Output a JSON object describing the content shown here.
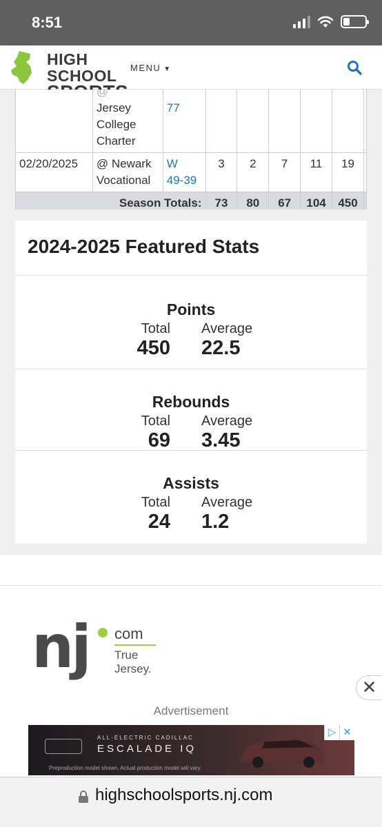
{
  "status_bar": {
    "time": "8:51"
  },
  "header": {
    "logo_line1": "HIGH SCHOOL",
    "logo_line2": "SPORTS",
    "menu_label": "MENU"
  },
  "game_log": {
    "partial_row": {
      "opponent": [
        "@ ",
        "Jersey",
        "College",
        "Charter"
      ],
      "result_tail": "77"
    },
    "row": {
      "date": "02/20/2025",
      "opponent_line1": "@ Newark",
      "opponent_line2": "Vocational",
      "result_line1": "W",
      "result_line2": "49-39",
      "stats": [
        "3",
        "2",
        "7",
        "11",
        "19"
      ]
    },
    "totals": {
      "label": "Season Totals:",
      "values": [
        "73",
        "80",
        "67",
        "104",
        "450"
      ]
    }
  },
  "featured": {
    "title": "2024-2025 Featured Stats",
    "total_label": "Total",
    "average_label": "Average",
    "stats": [
      {
        "name": "Points",
        "total": "450",
        "average": "22.5"
      },
      {
        "name": "Rebounds",
        "total": "69",
        "average": "3.45"
      },
      {
        "name": "Assists",
        "total": "24",
        "average": "1.2"
      }
    ]
  },
  "footer_logo": {
    "brand": "nj",
    "dot": "com",
    "tag1": "True",
    "tag2": "Jersey."
  },
  "ad": {
    "label": "Advertisement",
    "brand": "ALL-ELECTRIC CADILLAC",
    "model": "ESCALADE IQ",
    "fine_print": "Preproduction model shown. Actual production model will vary."
  },
  "url_bar": {
    "url": "highschoolsports.nj.com"
  }
}
